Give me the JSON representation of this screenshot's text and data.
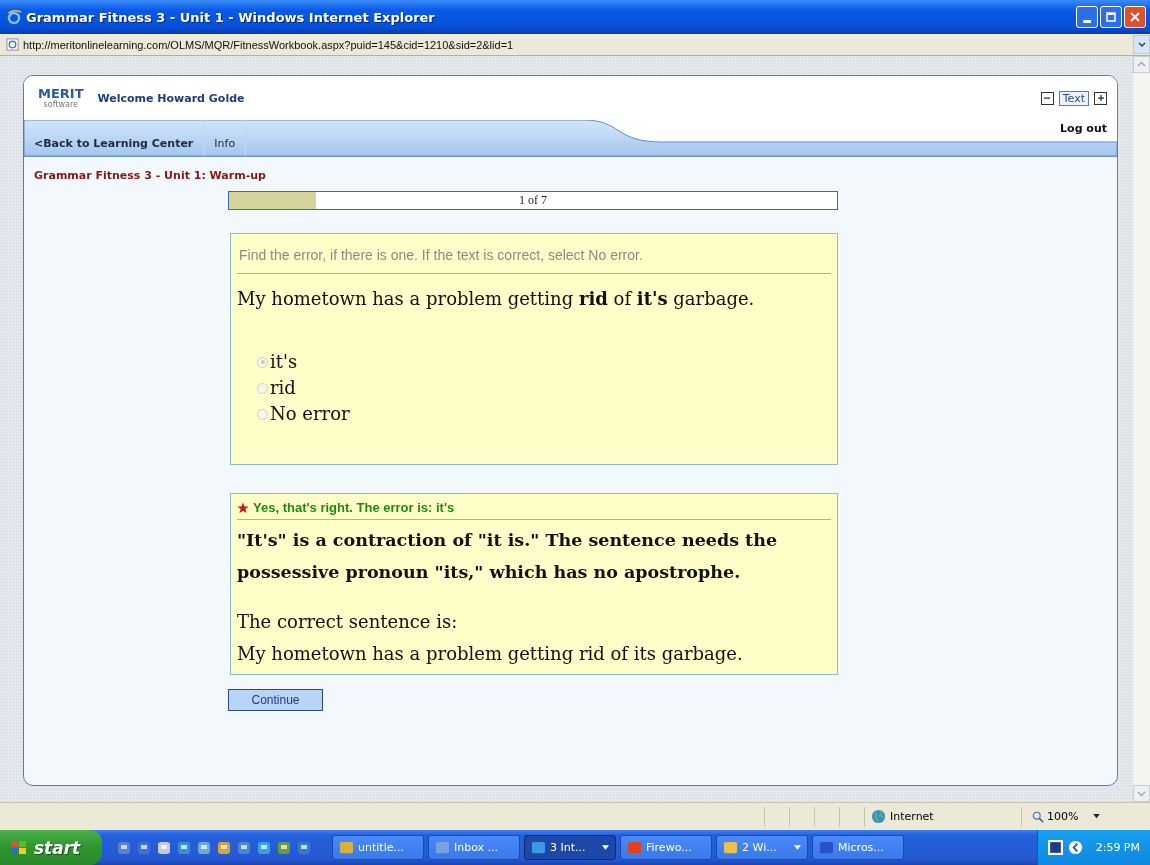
{
  "window": {
    "title": "Grammar Fitness 3 - Unit 1 - Windows Internet Explorer"
  },
  "address_bar": {
    "url": "http://meritonlinelearning.com/OLMS/MQR/FitnessWorkbook.aspx?puid=145&cid=1210&sid=2&lid=1"
  },
  "header": {
    "logo": "MERIT",
    "logo_sub": "software",
    "welcome": "Welcome Howard Golde",
    "text_size_label": "Text"
  },
  "nav": {
    "tabs": [
      {
        "label": "<Back to Learning Center",
        "selected": false
      },
      {
        "label": "Info",
        "selected": false
      }
    ],
    "logout": "Log out"
  },
  "breadcrumb": "Grammar Fitness 3 - Unit 1: Warm-up",
  "progress": {
    "label": "1 of 7",
    "level": 0.143
  },
  "question": {
    "instruction": "Find the error, if there is one. If the text is correct, select No error.",
    "sentence": "My hometown has a problem getting **rid** of **it's** garbage.",
    "disabled": true,
    "options": [
      {
        "label": "it's",
        "selected": true
      },
      {
        "label": "rid",
        "selected": false
      },
      {
        "label": "No error",
        "selected": false
      }
    ]
  },
  "feedback": {
    "headline": "Yes, that's right. The error is: it's",
    "explanation": "\"It's\" is a contraction of \"it is.\" The sentence needs the possessive pronoun \"its,\" which has no apostrophe.",
    "correct_label": "The correct sentence is:",
    "correct_sentence": "My hometown has a problem getting rid of its garbage."
  },
  "continue_button": "Continue",
  "status_bar": {
    "zone": "Internet",
    "zoom": "100%"
  },
  "taskbar": {
    "start": "start",
    "tasks": [
      {
        "label": "untitle...",
        "active": false,
        "menu": false
      },
      {
        "label": "Inbox ...",
        "active": false,
        "menu": false
      },
      {
        "label": "3 Int...",
        "active": true,
        "menu": true
      },
      {
        "label": "Firewo...",
        "active": false,
        "menu": false
      },
      {
        "label": "2 Wi...",
        "active": false,
        "menu": true
      },
      {
        "label": "Micros...",
        "active": false,
        "menu": false
      }
    ],
    "clock": "2:59 PM"
  }
}
